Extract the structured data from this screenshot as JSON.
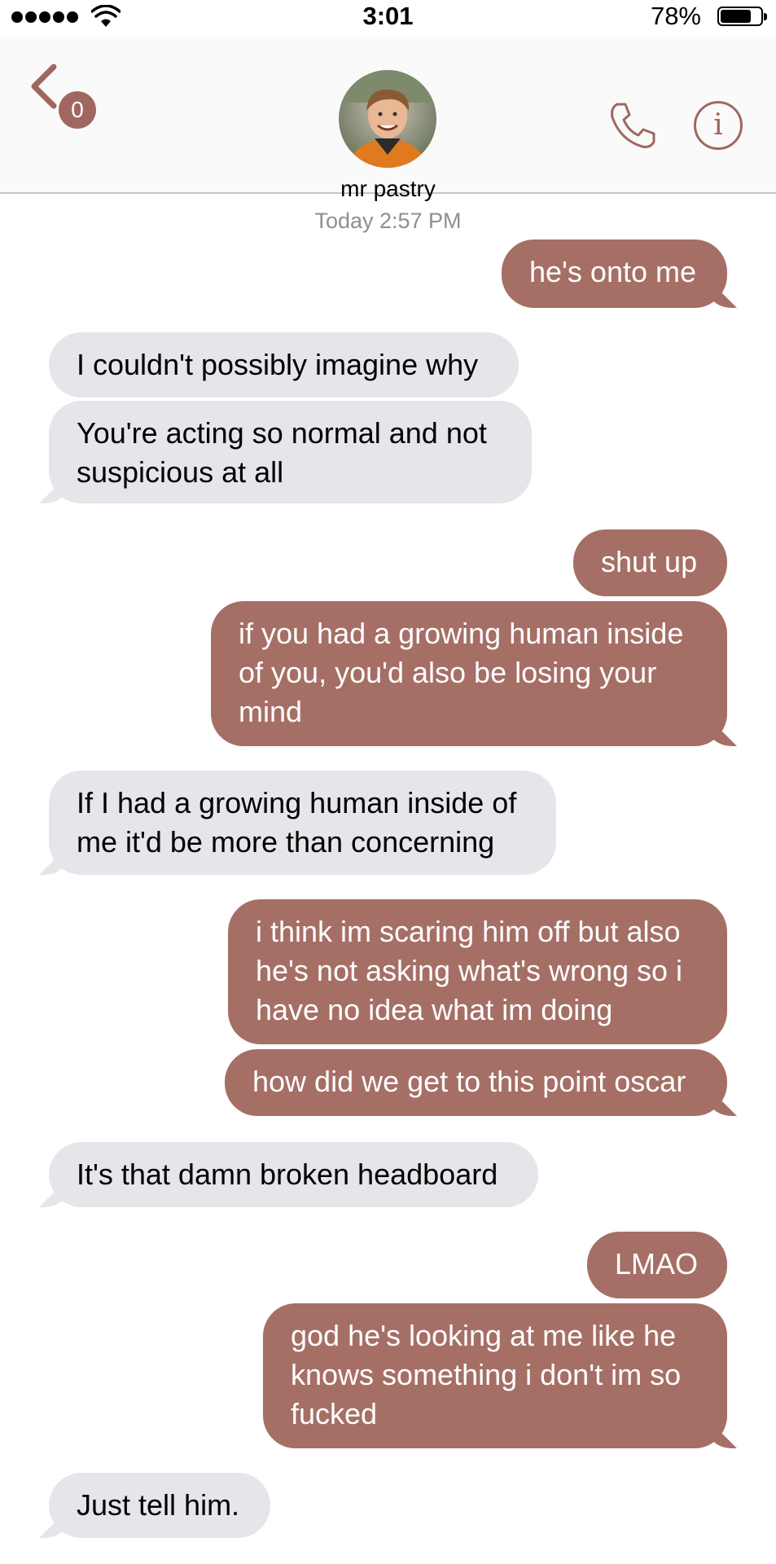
{
  "status_bar": {
    "time": "3:01",
    "battery_percent": "78%",
    "battery_level": 0.78,
    "signal_bars": 5
  },
  "header": {
    "back_badge": "0",
    "contact_name": "mr pastry",
    "info_glyph": "i",
    "icons": [
      "back-chevron-icon",
      "phone-icon",
      "info-icon"
    ]
  },
  "conversation": {
    "timestamp": "Today 2:57 PM",
    "messages": [
      {
        "from": "me",
        "text": "he's onto me"
      },
      {
        "from": "them",
        "text": "I couldn't possibly imagine why"
      },
      {
        "from": "them",
        "text": "You're acting so normal and not suspicious at all"
      },
      {
        "from": "me",
        "text": "shut up"
      },
      {
        "from": "me",
        "text": "if you had a growing human inside of you, you'd also be losing your mind"
      },
      {
        "from": "them",
        "text": "If I had a growing human inside of me it'd be more than concerning"
      },
      {
        "from": "me",
        "text": "i think im scaring him off but also he's not asking what's wrong so i have no idea what im doing"
      },
      {
        "from": "me",
        "text": "how did we get to this point oscar"
      },
      {
        "from": "them",
        "text": "It's that damn broken headboard"
      },
      {
        "from": "me",
        "text": "LMAO"
      },
      {
        "from": "me",
        "text": "god he's looking at me like he knows something i don't im so fucked"
      },
      {
        "from": "them",
        "text": "Just tell him."
      }
    ]
  },
  "colors": {
    "accent": "#a06760",
    "outgoing_bubble": "#a56f66",
    "incoming_bubble": "#e5e5ea"
  }
}
